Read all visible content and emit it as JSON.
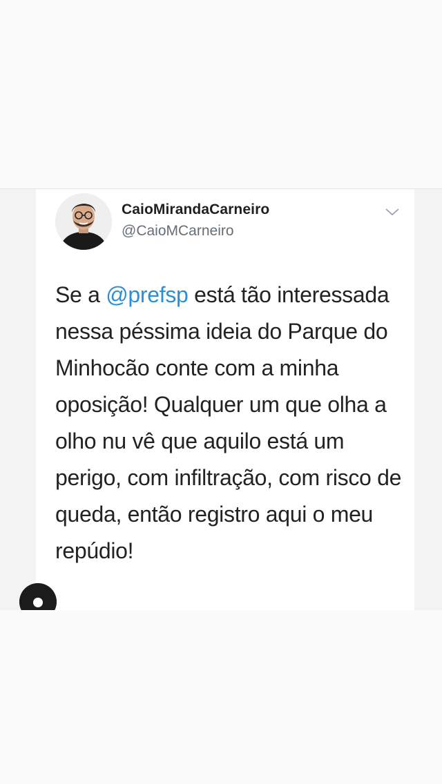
{
  "tweet": {
    "display_name": "CaioMirandaCarneiro",
    "handle": "@CaioMCarneiro",
    "text_prefix": "Se a ",
    "mention": "@prefsp",
    "text_rest": " está tão interessada nessa péssima ideia do Parque do Minhocão conte com a minha oposição! Qualquer um que olha a olho nu vê que aquilo está um perigo, com infiltração, com risco de queda, então registro aqui o meu repúdio!",
    "mention_color": "#2b8fd6"
  },
  "icons": {
    "menu": "chevron-down-icon",
    "profile": "profile-icon"
  }
}
